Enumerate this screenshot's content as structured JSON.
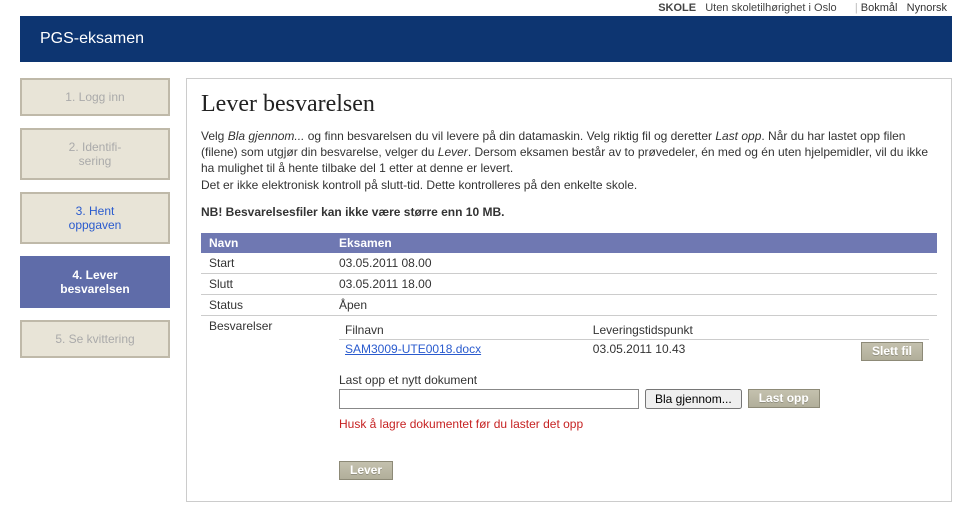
{
  "top": {
    "school_label": "SKOLE",
    "school_value": "Uten skoletilhørighet i Oslo",
    "lang_bokmal": "Bokmål",
    "lang_nynorsk": "Nynorsk",
    "sep": "|"
  },
  "banner": {
    "title": "PGS-eksamen"
  },
  "sidebar": {
    "steps": [
      {
        "label": "1. Logg inn"
      },
      {
        "label": "2. Identifi-\nsering"
      },
      {
        "label": "3. Hent\noppgaven"
      },
      {
        "label": "4. Lever\nbesvarelsen"
      },
      {
        "label": "5. Se kvittering"
      }
    ]
  },
  "content": {
    "heading": "Lever besvarelsen",
    "intro_parts": {
      "p1a": "Velg ",
      "p1_em1": "Bla gjennom...",
      "p1b": " og finn besvarelsen du vil levere på din datamaskin. Velg riktig fil og deretter ",
      "p1_em2": "Last opp",
      "p1c": ". Når du har lastet opp filen (filene) som utgjør din besvarelse, velger du ",
      "p1_em3": "Lever",
      "p1d": ". Dersom eksamen består av to prøvedeler, én med og én uten hjelpemidler, vil du ikke ha mulighet til å hente tilbake del 1 etter at denne er levert.",
      "p2": "Det er ikke elektronisk kontroll på slutt-tid. Dette kontrolleres på den enkelte skole."
    },
    "nb": "NB! Besvarelsesfiler kan ikke være større enn 10 MB.",
    "table": {
      "header_name": "Navn",
      "header_exam": "Eksamen",
      "rows": {
        "start_label": "Start",
        "start_value": "03.05.2011 08.00",
        "end_label": "Slutt",
        "end_value": "03.05.2011 18.00",
        "status_label": "Status",
        "status_value": "Åpen",
        "answers_label": "Besvarelser"
      }
    },
    "inner": {
      "col_file": "Filnavn",
      "col_time": "Leveringstidspunkt",
      "file_name": "SAM3009-UTE0018.docx",
      "file_time": "03.05.2011 10.43",
      "delete_label": "Slett fil"
    },
    "upload": {
      "label": "Last opp et nytt dokument",
      "browse": "Bla gjennom...",
      "upload_btn": "Last opp",
      "warn": "Husk å lagre dokumentet før du laster det opp"
    },
    "lever_btn": "Lever"
  }
}
